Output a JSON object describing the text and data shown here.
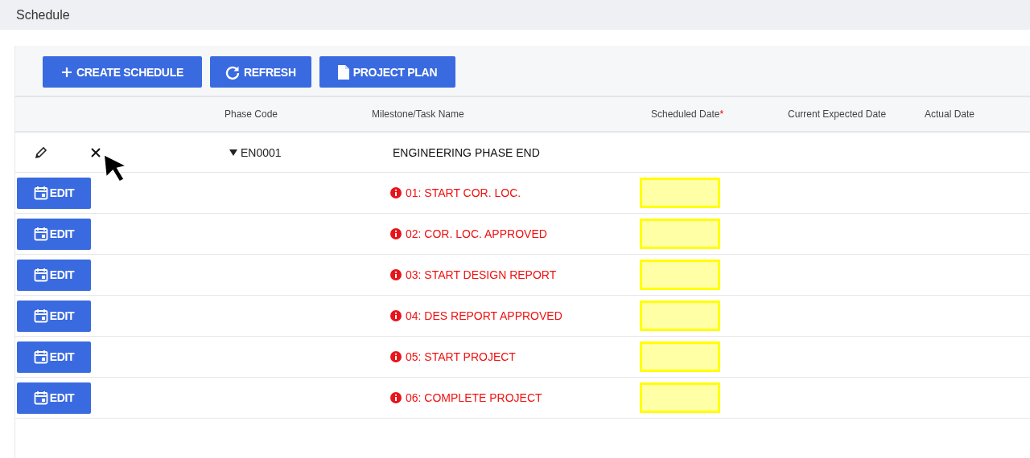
{
  "header": {
    "title": "Schedule"
  },
  "toolbar": [
    {
      "kind": "plus",
      "label": "CREATE SCHEDULE"
    },
    {
      "kind": "refresh",
      "label": "REFRESH"
    },
    {
      "kind": "document",
      "label": "PROJECT PLAN"
    }
  ],
  "table": {
    "columns": [
      {
        "label": "Phase Code"
      },
      {
        "label": "Milestone/Task Name"
      },
      {
        "label": "Scheduled Date",
        "required_mark": "*"
      },
      {
        "label": "Current Expected Date"
      },
      {
        "label": "Actual Date"
      }
    ],
    "rows": [
      {
        "phase_code": "EN0001",
        "expanded": true,
        "name": "ENGINEERING PHASE END",
        "children": [
          {
            "button": "EDIT",
            "name": "01: START COR. LOC."
          },
          {
            "button": "EDIT",
            "name": "02: COR. LOC. APPROVED"
          },
          {
            "button": "EDIT",
            "name": "03: START DESIGN REPORT"
          },
          {
            "button": "EDIT",
            "name": "04: DES REPORT APPROVED"
          },
          {
            "button": "EDIT",
            "name": "05: START PROJECT"
          },
          {
            "button": "EDIT",
            "name": "06: COMPLETE PROJECT"
          }
        ]
      }
    ]
  }
}
